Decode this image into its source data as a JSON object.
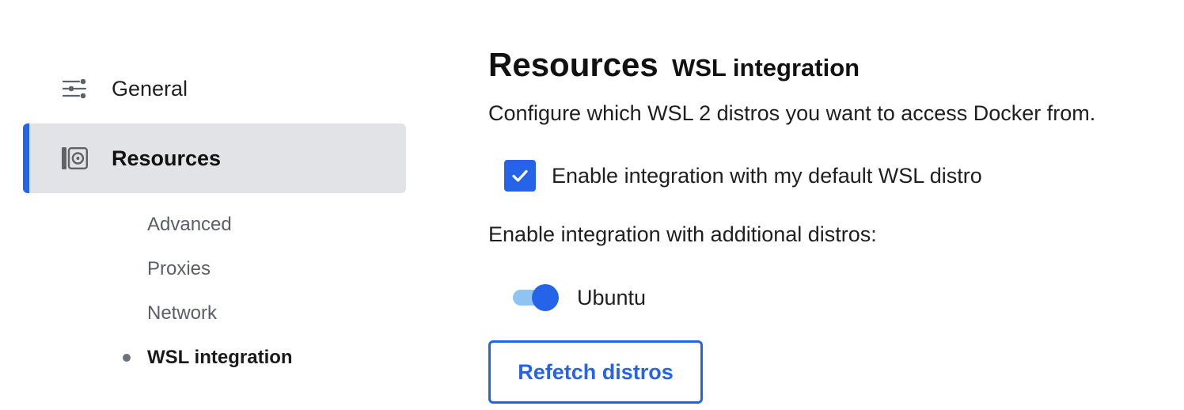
{
  "sidebar": {
    "items": [
      {
        "label": "General",
        "icon": "sliders-icon"
      },
      {
        "label": "Resources",
        "icon": "resources-disk-icon",
        "active": true
      }
    ],
    "sub_items": [
      {
        "label": "Advanced"
      },
      {
        "label": "Proxies"
      },
      {
        "label": "Network"
      },
      {
        "label": "WSL integration",
        "active": true
      }
    ]
  },
  "main": {
    "title": "Resources",
    "subtitle": "WSL integration",
    "description": "Configure which WSL 2 distros you want to access Docker from.",
    "default_distro": {
      "label": "Enable integration with my default WSL distro",
      "checked": true
    },
    "additional_label": "Enable integration with additional distros:",
    "distros": [
      {
        "name": "Ubuntu",
        "enabled": true
      }
    ],
    "refetch_label": "Refetch distros"
  },
  "colors": {
    "accent": "#2564e8",
    "active_nav_bg": "#e2e3e7",
    "toggle_track": "#8fc3f2"
  }
}
